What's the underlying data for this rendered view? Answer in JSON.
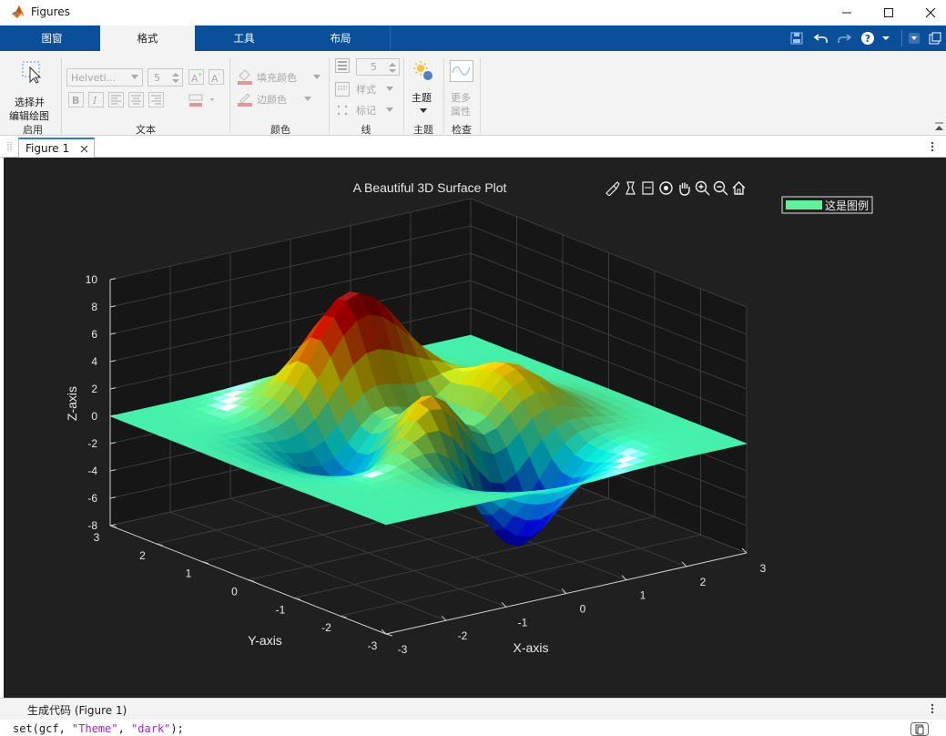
{
  "window": {
    "title": "Figures"
  },
  "tabs": [
    {
      "label": "图窗"
    },
    {
      "label": "格式"
    },
    {
      "label": "工具"
    },
    {
      "label": "布局"
    }
  ],
  "ribbon": {
    "select_edit": {
      "line1": "选择并",
      "line2": "编辑绘图"
    },
    "groups": {
      "enable": "启用",
      "text": "文本",
      "color": "颜色",
      "line": "线",
      "theme": "主题",
      "inspect": "检查"
    },
    "font_name": "Helveti...",
    "font_size": "5",
    "fill_color": "填充颜色",
    "edge_color": "边颜色",
    "line_width": "5",
    "style": "样式",
    "marker": "标记",
    "theme_button": "主题",
    "more_props": {
      "line1": "更多",
      "line2": "属性"
    }
  },
  "doc_tab": {
    "label": "Figure 1"
  },
  "plot": {
    "title": "A Beautiful 3D Surface Plot",
    "legend": "这是图例",
    "zlabel": "Z-axis",
    "xlabel": "X-axis",
    "ylabel": "Y-axis",
    "z_ticks": [
      "10",
      "8",
      "6",
      "4",
      "2",
      "0",
      "-2",
      "-4",
      "-6",
      "-8"
    ],
    "x_ticks": [
      "-3",
      "-2",
      "-1",
      "0",
      "1",
      "2",
      "3"
    ],
    "y_ticks": [
      "3",
      "2",
      "1",
      "0",
      "-1",
      "-2",
      "-3"
    ]
  },
  "chart_data": {
    "type": "surface",
    "title": "A Beautiful 3D Surface Plot",
    "xlabel": "X-axis",
    "ylabel": "Y-axis",
    "zlabel": "Z-axis",
    "xlim": [
      -3,
      3
    ],
    "ylim": [
      -3,
      3
    ],
    "zlim": [
      -8,
      10
    ],
    "function": "peaks",
    "max": 8.1,
    "min": -6.55,
    "colormap": "jet",
    "legend": [
      "这是图例"
    ],
    "legend_position": "top-right",
    "grid": true,
    "theme": "dark"
  },
  "code_panel": {
    "title": "生成代码 (Figure 1)",
    "code_prefix": "set(gcf, ",
    "str1": "\"Theme\"",
    "comma": ", ",
    "str2": "\"dark\"",
    "code_suffix": ");"
  },
  "colors": {
    "tabstrip": "#0a4f9a",
    "figure_bg": "#202020",
    "legend_swatch": "#5ef29a"
  }
}
